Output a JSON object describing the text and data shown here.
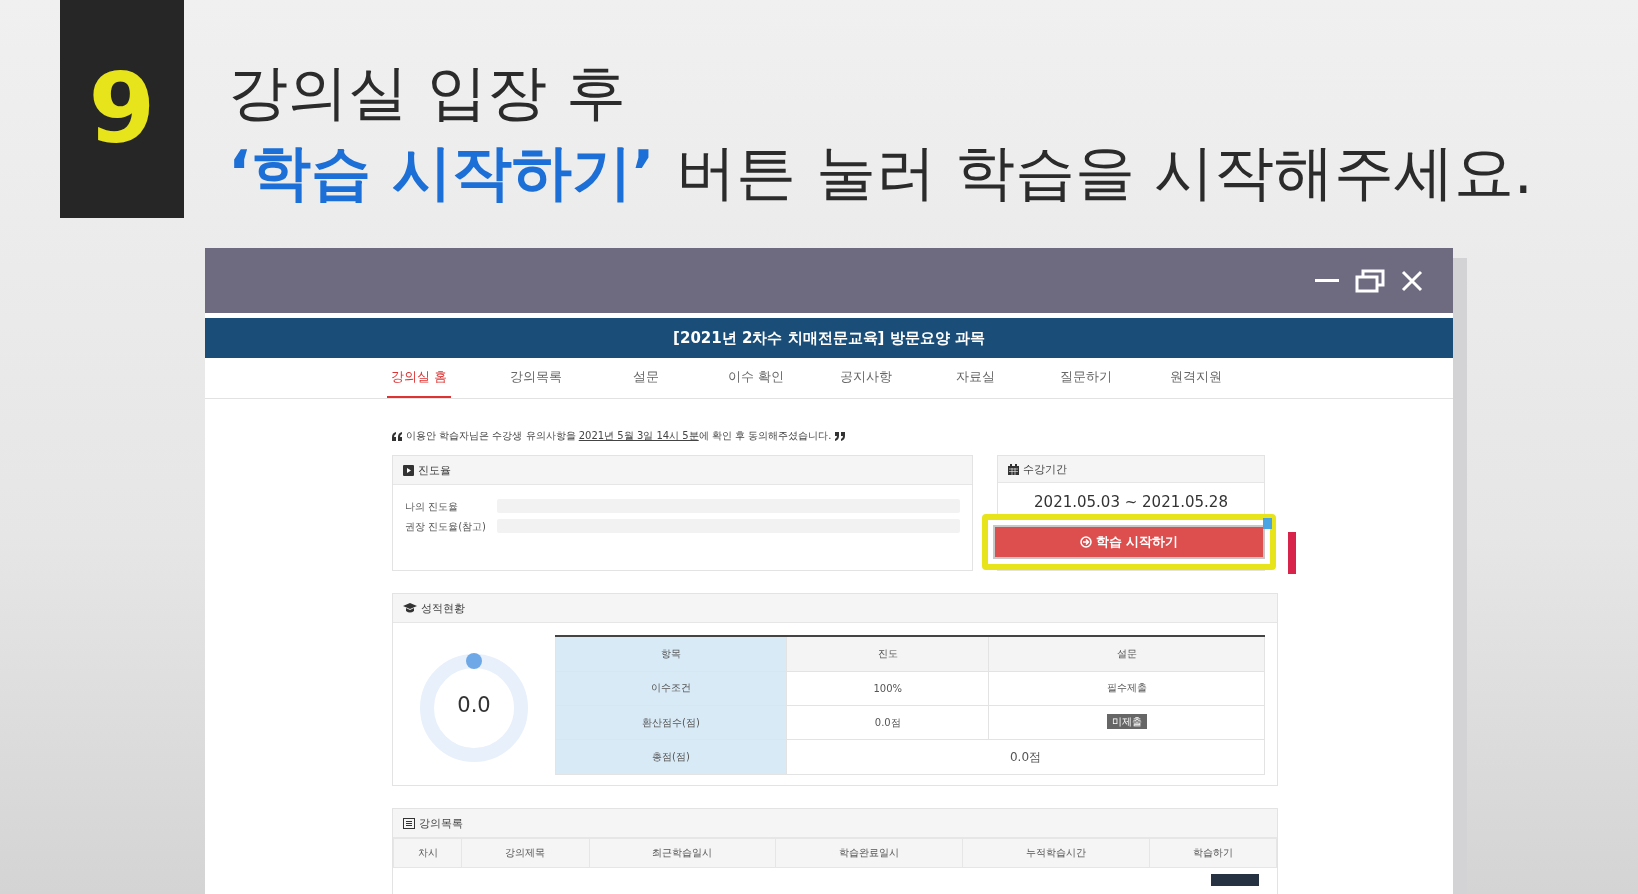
{
  "headline": {
    "number": "9",
    "line_1": "강의실 입장 후",
    "line_2_highlight": "‘학습 시작하기’",
    "line_2_rest": "버튼 눌러 학습을 시작해주세요."
  },
  "window": {
    "course_title": "[2021년 2차수 치매전문교육] 방문요양 과목"
  },
  "nav_tabs": [
    {
      "label": "강의실 홈",
      "selected": true
    },
    {
      "label": "강의목록",
      "selected": false
    },
    {
      "label": "설문",
      "selected": false
    },
    {
      "label": "이수 확인",
      "selected": false
    },
    {
      "label": "공지사항",
      "selected": false
    },
    {
      "label": "자료실",
      "selected": false
    },
    {
      "label": "질문하기",
      "selected": false
    },
    {
      "label": "원격지원",
      "selected": false
    }
  ],
  "notice": {
    "before": "이용안 학습자님은 수강생 유의사항을 ",
    "link": "2021년 5월 3일 14시 5분",
    "after": "에 확인 후 동의해주셨습니다."
  },
  "progress": {
    "title": "진도율",
    "rows": [
      {
        "label": "나의 진도율",
        "level": 0
      },
      {
        "label": "권장 진도율(참고)",
        "level": 0
      }
    ]
  },
  "period": {
    "title": "수강기간",
    "dates": "2021.05.03 ~ 2021.05.28",
    "start_button": "학습 시작하기"
  },
  "score": {
    "title": "성적현황",
    "donut": {
      "value": "0.0",
      "level": 0
    },
    "columns": [
      "항목",
      "진도",
      "설문"
    ],
    "rows": [
      {
        "cells": [
          {
            "kind": "label",
            "text": "이수조건"
          },
          {
            "kind": "plain",
            "text": "100%"
          },
          {
            "kind": "plain",
            "text": "필수제출"
          }
        ]
      },
      {
        "cells": [
          {
            "kind": "label",
            "text": "환산점수(점)"
          },
          {
            "kind": "plain",
            "text": "0.0점"
          },
          {
            "kind": "badge",
            "text": "미제출"
          }
        ]
      },
      {
        "cells": [
          {
            "kind": "label",
            "text": "총점(점)"
          },
          {
            "kind": "span",
            "text": "0.0점",
            "colspan": 2
          }
        ]
      }
    ]
  },
  "lectures": {
    "title": "강의목록",
    "columns": [
      "차시",
      "강의제목",
      "최근학습일시",
      "학습완료일시",
      "누적학습시간",
      "학습하기"
    ]
  }
}
